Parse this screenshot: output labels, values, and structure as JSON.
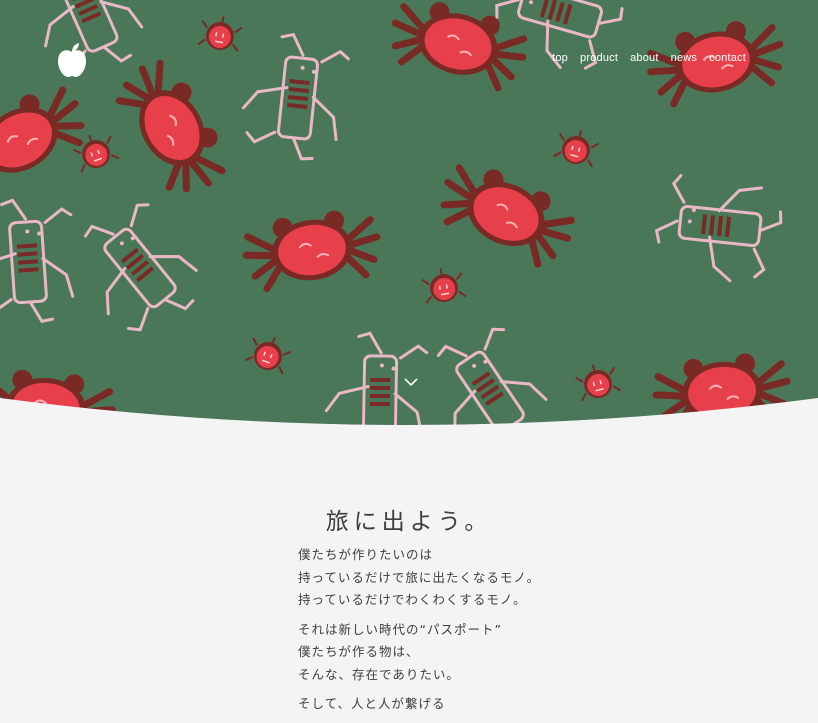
{
  "nav": {
    "items": [
      "top",
      "product",
      "about",
      "news",
      "contact"
    ]
  },
  "icons": {
    "logo": "apple-logo-icon",
    "scroll": "chevron-down-icon"
  },
  "colors": {
    "hero_background": "#4f7b5c",
    "crab_red": "#e8404a",
    "crab_dark": "#7a2a25",
    "frog_pink": "#e8b8c4",
    "page_background": "#f4f4f4",
    "text": "#3e3e3e"
  },
  "main": {
    "heading": "旅に出よう。",
    "paragraphs": [
      [
        "僕たちが作りたいのは",
        "持っているだけで旅に出たくなるモノ。",
        "持っているだけでわくわくするモノ。"
      ],
      [
        "それは新しい時代の“パスポート”",
        "僕たちが作る物は、",
        "そんな、存在でありたい。"
      ],
      [
        "そして、人と人が繋げる"
      ]
    ]
  }
}
